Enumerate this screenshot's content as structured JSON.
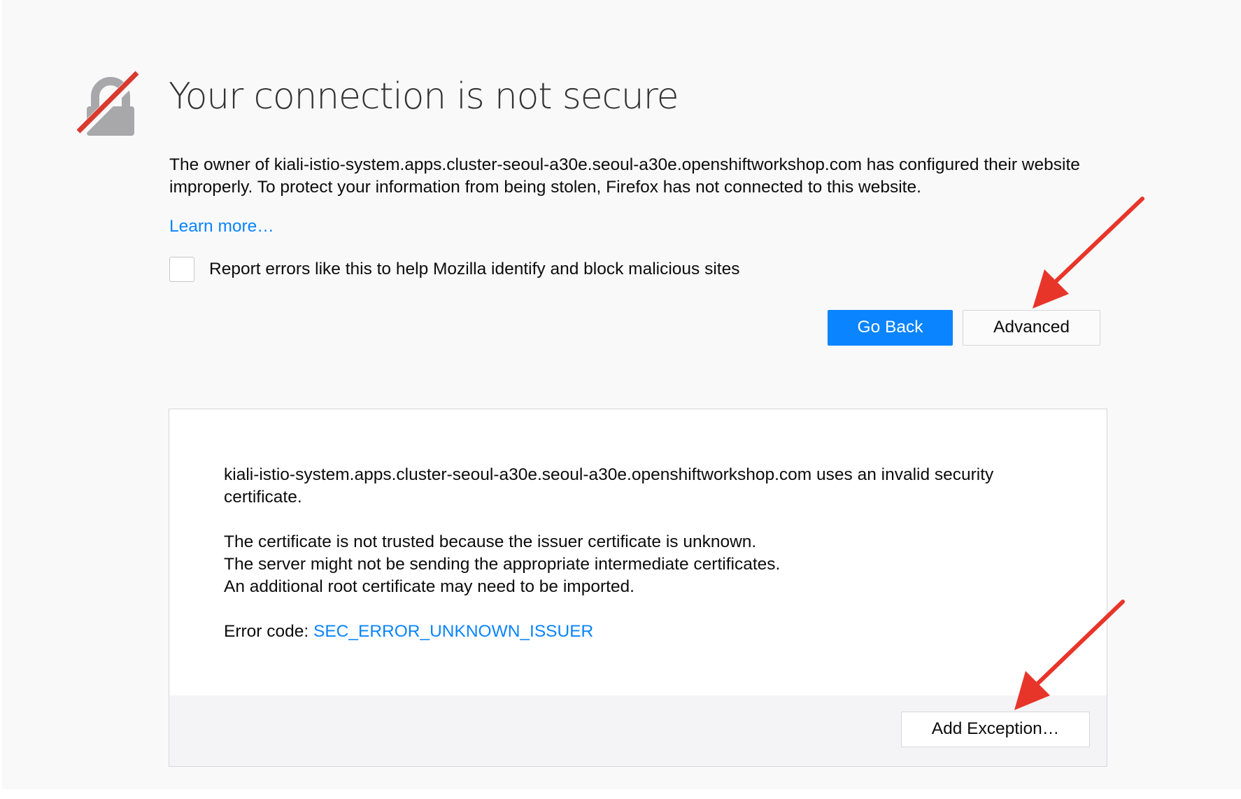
{
  "title": "Your connection is not secure",
  "description": "The owner of kiali-istio-system.apps.cluster-seoul-a30e.seoul-a30e.openshiftworkshop.com has configured their website improperly. To protect your information from being stolen, Firefox has not connected to this website.",
  "learn_more": "Learn more…",
  "report_checkbox": {
    "label": "Report errors like this to help Mozilla identify and block malicious sites",
    "checked": false
  },
  "buttons": {
    "go_back": "Go Back",
    "advanced": "Advanced",
    "add_exception": "Add Exception…"
  },
  "advanced_panel": {
    "invalid_cert": "kiali-istio-system.apps.cluster-seoul-a30e.seoul-a30e.openshiftworkshop.com uses an invalid security certificate.",
    "not_trusted": "The certificate is not trusted because the issuer certificate is unknown.",
    "intermediate": "The server might not be sending the appropriate intermediate certificates.",
    "root_cert": "An additional root certificate may need to be imported.",
    "error_code_label": "Error code: ",
    "error_code": "SEC_ERROR_UNKNOWN_ISSUER"
  },
  "colors": {
    "accent_blue": "#0a84ff",
    "annotation_red": "#e8352a",
    "lock_gray": "#a8a8ab",
    "lock_strike_red": "#d93a2e"
  },
  "icons": {
    "lock": "broken-lock-icon",
    "annotation": "red-arrow-annotation"
  }
}
